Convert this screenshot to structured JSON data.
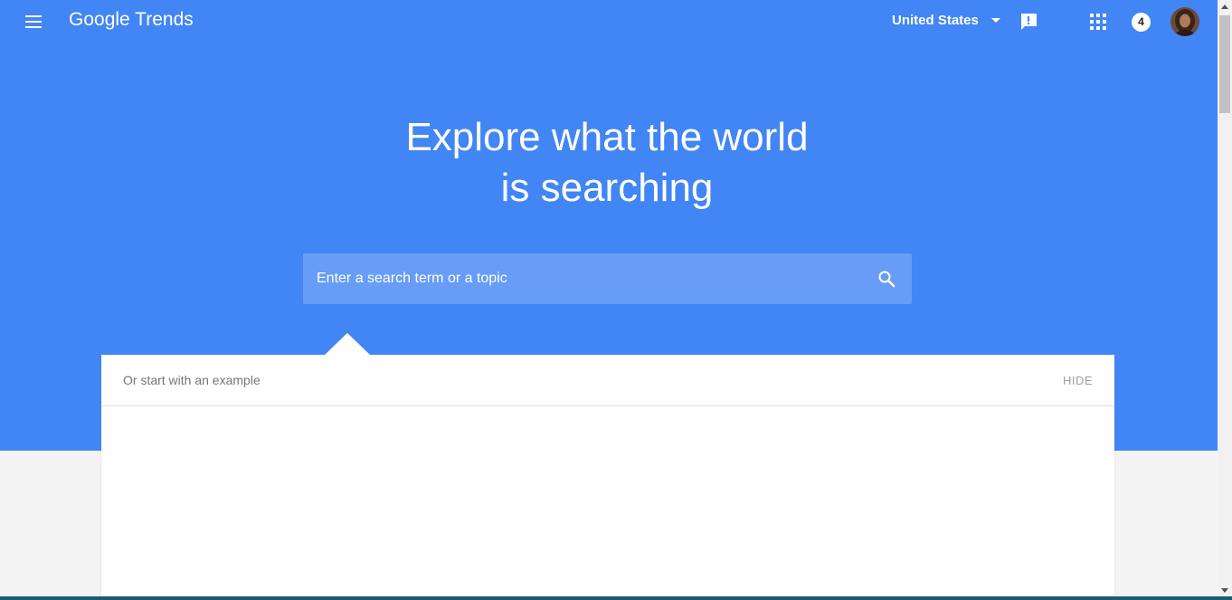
{
  "header": {
    "menu_icon": "menu-icon",
    "logo_text": "Google Trends",
    "country": "United States",
    "feedback_icon": "feedback-icon",
    "apps_icon": "apps-grid-icon",
    "notification_count": "4",
    "avatar": "account-avatar"
  },
  "hero": {
    "headline_line1": "Explore what the world",
    "headline_line2": "is searching",
    "background_color": "#4285f4"
  },
  "search": {
    "placeholder": "Enter a search term or a topic",
    "value": "",
    "icon": "search-icon"
  },
  "examples": {
    "title": "Or start with an example",
    "hide_label": "HIDE"
  }
}
